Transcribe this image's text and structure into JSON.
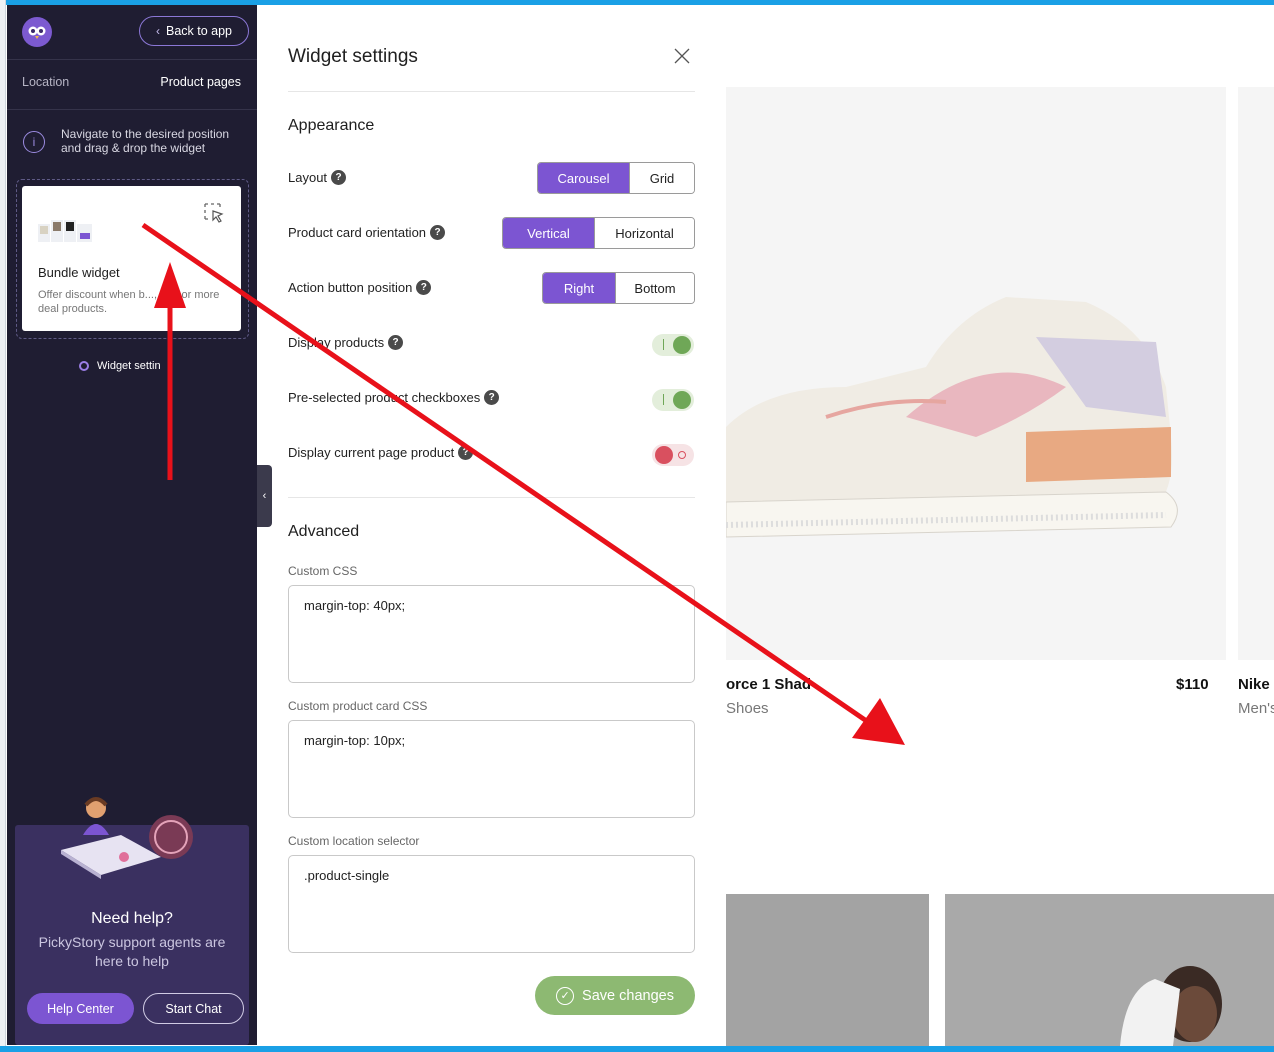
{
  "sidebar": {
    "back_label": "Back to app",
    "location_label": "Location",
    "location_value": "Product pages",
    "nav_hint": "Navigate to the desired position and drag & drop the widget",
    "widget_card": {
      "title": "Bundle widget",
      "description": "Offer discount when b..., one or more deal products."
    },
    "widget_settings_link": "Widget settin",
    "help": {
      "title": "Need help?",
      "text": "PickyStory support agents are here to help",
      "help_center_label": "Help Center",
      "start_chat_label": "Start Chat"
    }
  },
  "panel": {
    "title": "Widget settings",
    "appearance_title": "Appearance",
    "layout": {
      "label": "Layout",
      "options": [
        "Carousel",
        "Grid"
      ],
      "selected": "Carousel"
    },
    "orientation": {
      "label": "Product card orientation",
      "options": [
        "Vertical",
        "Horizontal"
      ],
      "selected": "Vertical"
    },
    "action_position": {
      "label": "Action button position",
      "options": [
        "Right",
        "Bottom"
      ],
      "selected": "Right"
    },
    "display_products": {
      "label": "Display products",
      "on": true
    },
    "preselected": {
      "label": "Pre-selected product checkboxes",
      "on": true
    },
    "current_page": {
      "label": "Display current page product",
      "on": false
    },
    "advanced_title": "Advanced",
    "custom_css": {
      "label": "Custom CSS",
      "value": "margin-top: 40px;"
    },
    "custom_card_css": {
      "label": "Custom product card CSS",
      "value": "margin-top: 10px;"
    },
    "custom_selector": {
      "label": "Custom location selector",
      "value": ".product-single"
    },
    "save_label": "Save changes"
  },
  "products": {
    "item1": {
      "name": "orce 1 Shad",
      "category": "Shoes",
      "price": "$110"
    },
    "item2": {
      "name": "Nike",
      "category": "Men's"
    }
  },
  "colors": {
    "accent": "#7c55d2",
    "sidebar_bg": "#1f1d32",
    "save": "#8db972",
    "toggle_on": "#6fa757",
    "toggle_off": "#d9505f",
    "annotation": "#e8111a"
  },
  "icons": {
    "logo": "owl-logo-icon",
    "back": "chevron-left-icon",
    "info": "info-icon",
    "drag": "drag-select-icon",
    "settings": "gear-icon",
    "close": "close-icon",
    "help": "question-icon",
    "save": "check-circle-icon"
  }
}
